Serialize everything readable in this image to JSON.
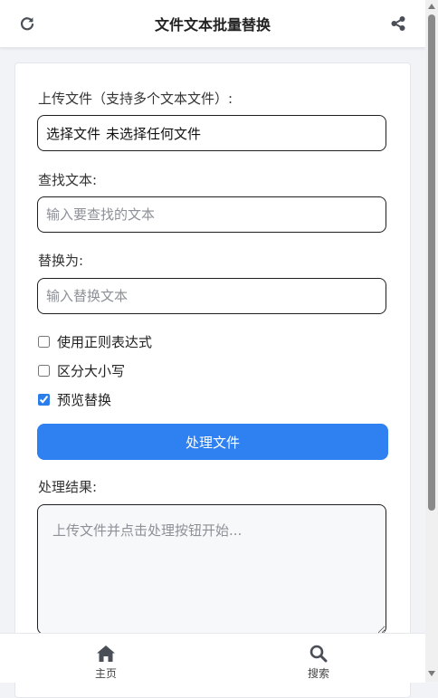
{
  "header": {
    "title": "文件文本批量替换",
    "refresh_icon": "refresh-icon",
    "share_icon": "share-icon"
  },
  "form": {
    "upload_label": "上传文件（支持多个文本文件）:",
    "file_button_text": "选择文件",
    "file_status_text": "未选择任何文件",
    "find_label": "查找文本:",
    "find_placeholder": "输入要查找的文本",
    "replace_label": "替换为:",
    "replace_placeholder": "输入替换文本",
    "options": [
      {
        "label": "使用正则表达式",
        "checked": false
      },
      {
        "label": "区分大小写",
        "checked": false
      },
      {
        "label": "预览替换",
        "checked": true
      }
    ],
    "process_button": "处理文件",
    "result_label": "处理结果:",
    "result_placeholder": "上传文件并点击处理按钮开始..."
  },
  "bottom_nav": {
    "items": [
      {
        "label": "主页",
        "icon": "home-icon"
      },
      {
        "label": "搜索",
        "icon": "search-icon"
      }
    ]
  },
  "colors": {
    "accent": "#2f80f0",
    "icon": "#4a4f57"
  }
}
